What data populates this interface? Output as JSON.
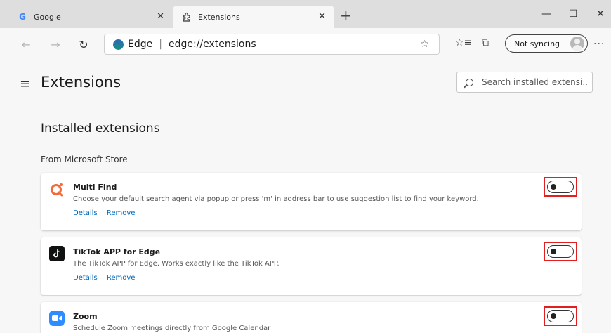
{
  "tabs": [
    {
      "title": "Google",
      "favicon": "G"
    },
    {
      "title": "Extensions"
    }
  ],
  "address": {
    "brand": "Edge",
    "separator": "|",
    "url": "edge://extensions"
  },
  "profile": {
    "label": "Not syncing"
  },
  "page": {
    "title": "Extensions",
    "search_placeholder": "Search installed extensi..."
  },
  "installed": {
    "heading": "Installed extensions",
    "store_label": "From Microsoft Store"
  },
  "extensions": [
    {
      "name": "Multi Find",
      "description": "Choose your default search agent via popup or press 'm' in address bar to use suggestion list to find your keyword.",
      "details": "Details",
      "remove": "Remove",
      "icon": "q-icon",
      "enabled": false
    },
    {
      "name": "TikTok APP for Edge",
      "description": "The TikTok APP for Edge. Works exactly like the TikTok APP.",
      "details": "Details",
      "remove": "Remove",
      "icon": "tiktok-icon",
      "enabled": false
    },
    {
      "name": "Zoom",
      "description": "Schedule Zoom meetings directly from Google Calendar",
      "icon": "zoom-icon",
      "enabled": false
    }
  ],
  "colors": {
    "accent_link": "#0067b8",
    "highlight_box": "#e02020",
    "zoom_blue": "#2d8cff",
    "multifind_orange": "#f26b3a"
  }
}
